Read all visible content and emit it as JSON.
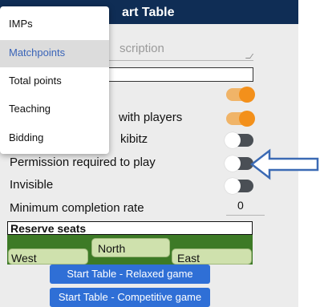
{
  "header": {
    "title": "art Table"
  },
  "description": {
    "placeholder": "scription"
  },
  "menu": {
    "items": [
      {
        "label": "IMPs",
        "selected": false
      },
      {
        "label": "Matchpoints",
        "selected": true
      },
      {
        "label": "Total points",
        "selected": false
      },
      {
        "label": "Teaching",
        "selected": false
      },
      {
        "label": "Bidding",
        "selected": false
      }
    ]
  },
  "settings": {
    "with_players_label": "with players",
    "kibitz_label": "kibitz",
    "permission_label": "Permission required to play",
    "invisible_label": "Invisible",
    "completion_label": "Minimum completion rate",
    "completion_value": "0",
    "toggles": {
      "row1": "on",
      "with_players": "on",
      "kibitz": "off",
      "permission": "off",
      "invisible": "off"
    }
  },
  "reserve": {
    "label": "Reserve seats",
    "seats": {
      "west": "West",
      "north": "North",
      "east": "East"
    }
  },
  "buttons": {
    "relaxed": "Start Table - Relaxed game",
    "competitive": "Start Table - Competitive game"
  },
  "colors": {
    "header_bg": "#0f2d55",
    "toggle_on": "#f3901b",
    "toggle_off": "#4a4f55",
    "button_bg": "#2f6fd6",
    "seat_area": "#3d7a26",
    "arrow": "#3b6ab4"
  }
}
